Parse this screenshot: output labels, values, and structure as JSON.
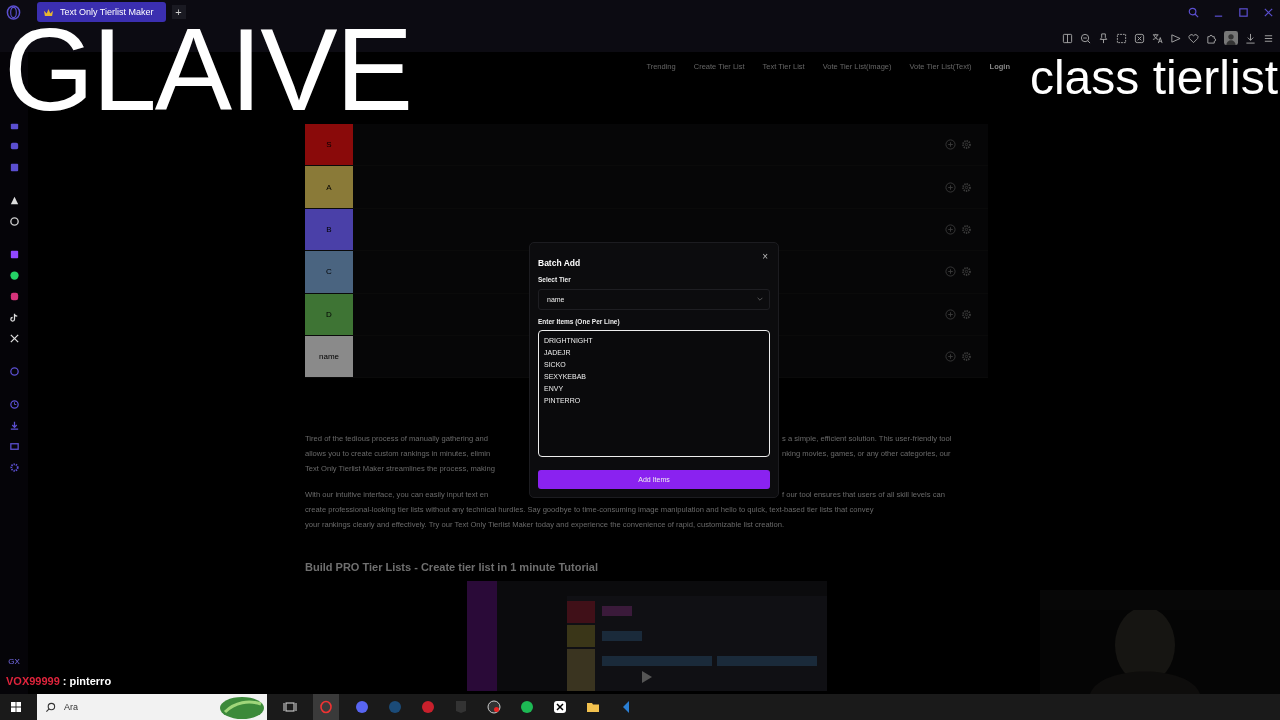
{
  "browser": {
    "tab": {
      "title": "Text Only Tierlist Maker",
      "selected": true
    },
    "new_tab": "+"
  },
  "site": {
    "nav": [
      "Trending",
      "Create Tier List",
      "Text Tier List",
      "Vote Tier List(image)",
      "Vote Tier List(Text)",
      "Login"
    ],
    "tiers": [
      {
        "label": "S",
        "color": "#8a0a0a"
      },
      {
        "label": "A",
        "color": "#8a7a38"
      },
      {
        "label": "B",
        "color": "#4a40a8"
      },
      {
        "label": "C",
        "color": "#4a6480"
      },
      {
        "label": "D",
        "color": "#3e7434"
      },
      {
        "label": "name",
        "color": "#8a8a8a"
      }
    ],
    "paragraph_lines": [
      {
        "left": "Tired of the tedious process of manually gathering and",
        "right": "s a simple, efficient solution. This user-friendly tool"
      },
      {
        "left": "allows you to create custom rankings in minutes, elimin",
        "right": "nking movies, games, or any other categories, our"
      },
      {
        "left": "Text Only Tierlist Maker streamlines the process, making"
      },
      {
        "left": "With our intuitive interface, you can easily input text en",
        "right": "f our tool ensures that users of all skill levels can",
        "gap_before": true
      },
      {
        "full": "create professional-looking tier lists without any technical hurdles. Say goodbye to time-consuming image manipulation and hello to quick, text-based tier lists that convey"
      },
      {
        "full": "your rankings clearly and effectively. Try our Text Only Tierlist Maker today and experience the convenience of rapid, customizable list creation."
      }
    ],
    "tutorial_heading": "Build PRO Tier Lists - Create tier list in 1 minute Tutorial"
  },
  "modal": {
    "title": "Batch Add",
    "close": "×",
    "select_label": "Select Tier",
    "select_value": "name",
    "items_label": "Enter Items (One Per Line)",
    "items": "DRIGHTNIGHT\nJADEJR\nSICKO\nSEXYKEBAB\nENVY\nPINTERRO",
    "button": "Add Items"
  },
  "overlay": {
    "title": "GLAIVE",
    "subtitle": "class tierlist",
    "chat": {
      "user": "VOX99999",
      "message": ": pinterro"
    }
  },
  "sidebar": {
    "badge": "GX"
  },
  "taskbar": {
    "search_value": "Ara"
  }
}
